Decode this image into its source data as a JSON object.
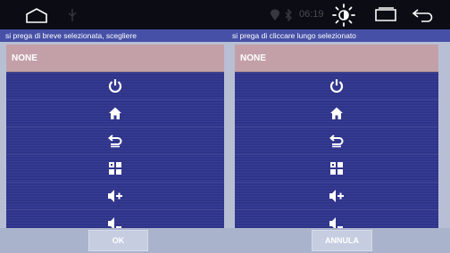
{
  "status_bar": {
    "time": "06:19",
    "icons": [
      "home-icon",
      "usb-icon",
      "location-icon",
      "bluetooth-icon",
      "brightness-icon",
      "recent-apps-icon",
      "back-icon"
    ]
  },
  "left_panel": {
    "title": "si prega di breve selezionata, scegliere",
    "selected_label": "NONE",
    "items": [
      "power-icon",
      "home-icon",
      "return-icon",
      "apps-icon",
      "volume-up-icon",
      "volume-down-icon"
    ]
  },
  "right_panel": {
    "title": "si prega di cliccare lungo selezionato",
    "selected_label": "NONE",
    "items": [
      "power-icon",
      "home-icon",
      "return-icon",
      "apps-icon",
      "volume-up-icon",
      "volume-down-icon"
    ]
  },
  "buttons": {
    "ok": "OK",
    "cancel": "ANNULA"
  },
  "colors": {
    "panel": "#2f3488",
    "title_bar": "#4650a6",
    "selected_row": "#c3a0a8"
  }
}
